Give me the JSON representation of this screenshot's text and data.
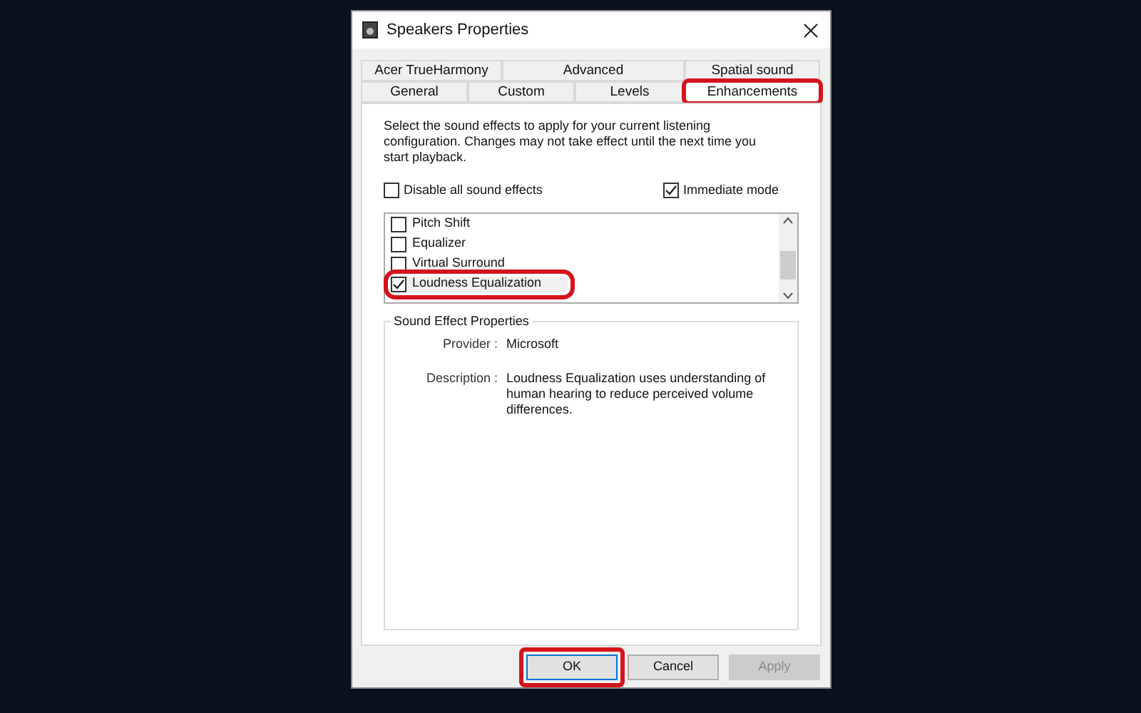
{
  "window": {
    "title": "Speakers Properties"
  },
  "tabs": [
    [
      {
        "label": "Acer TrueHarmony",
        "selected": false,
        "highlighted": false
      },
      {
        "label": "Advanced",
        "selected": false,
        "highlighted": false
      },
      {
        "label": "Spatial sound",
        "selected": false,
        "highlighted": false
      }
    ],
    [
      {
        "label": "General",
        "selected": false,
        "highlighted": false
      },
      {
        "label": "Custom",
        "selected": false,
        "highlighted": false
      },
      {
        "label": "Levels",
        "selected": false,
        "highlighted": false
      },
      {
        "label": "Enhancements",
        "selected": true,
        "highlighted": true
      }
    ]
  ],
  "intro": "Select the sound effects to apply for your current listening configuration. Changes may not take effect until the next time you start playback.",
  "options": [
    {
      "label": "Disable all sound effects",
      "checked": false
    },
    {
      "label": "Immediate mode",
      "checked": true
    }
  ],
  "effects": [
    {
      "label": "Pitch Shift",
      "checked": false,
      "highlighted": false
    },
    {
      "label": "Equalizer",
      "checked": false,
      "highlighted": false
    },
    {
      "label": "Virtual Surround",
      "checked": false,
      "highlighted": false
    },
    {
      "label": "Loudness Equalization",
      "checked": true,
      "highlighted": true
    }
  ],
  "properties": {
    "title": "Sound Effect Properties",
    "rows": [
      {
        "label": "Provider :",
        "value": "Microsoft"
      },
      {
        "label": "Description :",
        "value": "Loudness Equalization uses understanding of human hearing to reduce perceived volume differences."
      }
    ]
  },
  "buttons": [
    {
      "label": "OK",
      "disabled": false,
      "highlighted": true
    },
    {
      "label": "Cancel",
      "disabled": false,
      "highlighted": false
    },
    {
      "label": "Apply",
      "disabled": true,
      "highlighted": false
    }
  ]
}
